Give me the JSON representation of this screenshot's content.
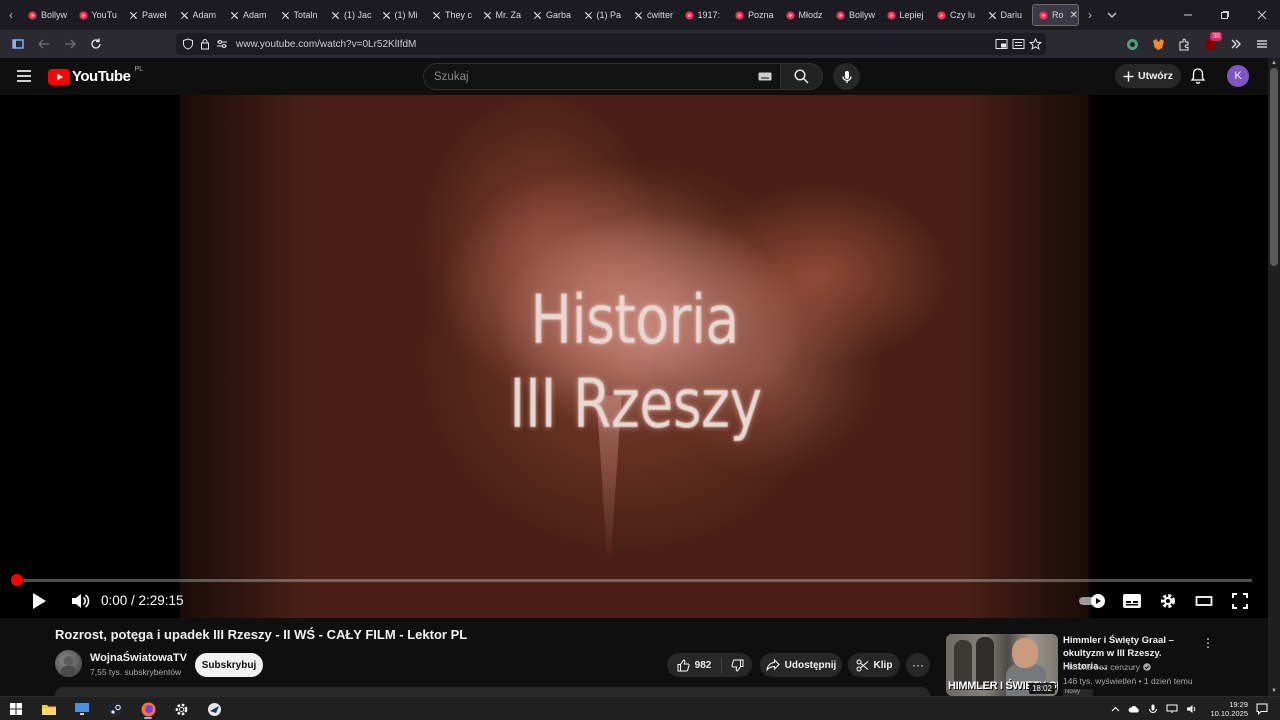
{
  "browser": {
    "tabs": [
      {
        "label": "Bollyw",
        "icon": "youtube"
      },
      {
        "label": "YouTu",
        "icon": "youtube"
      },
      {
        "label": "Paweł",
        "icon": "x"
      },
      {
        "label": "Adam",
        "icon": "x"
      },
      {
        "label": "Adam",
        "icon": "x"
      },
      {
        "label": "Totaln",
        "icon": "x"
      },
      {
        "label": "(1) Jac",
        "icon": "x"
      },
      {
        "label": "(1) Mi",
        "icon": "x"
      },
      {
        "label": "They c",
        "icon": "x"
      },
      {
        "label": "Mr. Za",
        "icon": "x"
      },
      {
        "label": "Garba",
        "icon": "x"
      },
      {
        "label": "(1) Pa",
        "icon": "x"
      },
      {
        "label": "ćwitter",
        "icon": "x"
      },
      {
        "label": "1917:",
        "icon": "youtube"
      },
      {
        "label": "Pozna",
        "icon": "youtube"
      },
      {
        "label": "Młodz",
        "icon": "youtube"
      },
      {
        "label": "Bollyw",
        "icon": "youtube"
      },
      {
        "label": "Lepiej",
        "icon": "youtube"
      },
      {
        "label": "Czy lu",
        "icon": "youtube"
      },
      {
        "label": "Dariu",
        "icon": "x"
      }
    ],
    "active_tab": {
      "label": "Roz",
      "icon": "youtube"
    },
    "url": "www.youtube.com/watch?v=0Lr52KlIfdM",
    "extension_badge": "38"
  },
  "youtube": {
    "logo_text": "YouTube",
    "region": "PL",
    "search_placeholder": "Szukaj",
    "create_label": "Utwórz",
    "avatar_letter": "K",
    "accent": "#ff0000"
  },
  "player": {
    "title_line1": "Historia",
    "title_line2": "III Rzeszy",
    "current_time": "0:00",
    "duration": "2:29:15",
    "time_display": "0:00 / 2:29:15",
    "progress_fraction": 0
  },
  "video": {
    "title": "Rozrost, potęga i upadek III Rzeszy - II WŚ - CAŁY FILM - Lektor PL",
    "channel": "WojnaŚwiatowaTV",
    "subscribers": "7,55 tys. subskrybentów",
    "subscribe_label": "Subskrybuj",
    "likes": "982",
    "share_label": "Udostępnij",
    "clip_label": "Klip"
  },
  "recommendation": {
    "title": "Himmler i Święty Graal – okultyzm w III Rzeszy. Historia…",
    "channel": "Historia bez cenzury",
    "views": "146 tys. wyświetleń",
    "age": "1 dzień temu",
    "meta": "146 tys. wyświetleń • 1 dzień temu",
    "thumb_text": "HIMMLER I ŚWIĘTY GRAAL",
    "duration": "18:02",
    "badge": "Nowy"
  },
  "taskbar": {
    "time": "19:29",
    "date": "10.10.2025"
  }
}
